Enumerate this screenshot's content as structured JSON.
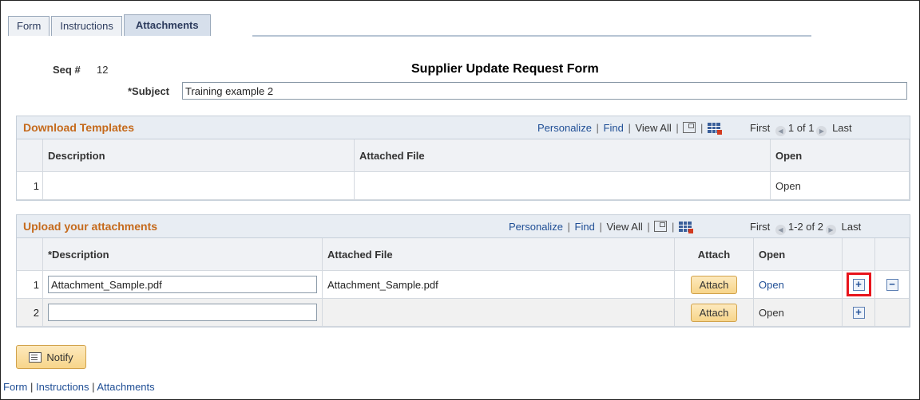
{
  "tabs": {
    "form": "Form",
    "instructions": "Instructions",
    "attachments": "Attachments"
  },
  "header": {
    "seq_label": "Seq #",
    "seq_value": "12",
    "title": "Supplier Update Request Form"
  },
  "subject": {
    "label": "*Subject",
    "value": "Training example 2"
  },
  "download_templates": {
    "title": "Download Templates",
    "personalize": "Personalize",
    "find": "Find",
    "view_all": "View All",
    "first": "First",
    "range": "1 of 1",
    "last": "Last",
    "columns": {
      "description": "Description",
      "attached_file": "Attached File",
      "open": "Open"
    },
    "rows": [
      {
        "num": "1",
        "description": "",
        "attached_file": "",
        "open": "Open"
      }
    ]
  },
  "uploads": {
    "title": "Upload your attachments",
    "personalize": "Personalize",
    "find": "Find",
    "view_all": "View All",
    "first": "First",
    "range": "1-2 of 2",
    "last": "Last",
    "columns": {
      "description": "*Description",
      "attached_file": "Attached File",
      "attach": "Attach",
      "open": "Open"
    },
    "rows": [
      {
        "num": "1",
        "description": "Attachment_Sample.pdf",
        "attached_file": "Attachment_Sample.pdf",
        "attach": "Attach",
        "open": "Open"
      },
      {
        "num": "2",
        "description": "",
        "attached_file": "",
        "attach": "Attach",
        "open": "Open"
      }
    ],
    "add_symbol": "+",
    "delete_symbol": "−"
  },
  "notify_label": "Notify",
  "footer": {
    "form": "Form",
    "instructions": "Instructions",
    "attachments": "Attachments",
    "separator": "|"
  },
  "colors": {
    "section_title": "#c56a1c",
    "link": "#1f4e95",
    "highlight": "#e8141c"
  }
}
